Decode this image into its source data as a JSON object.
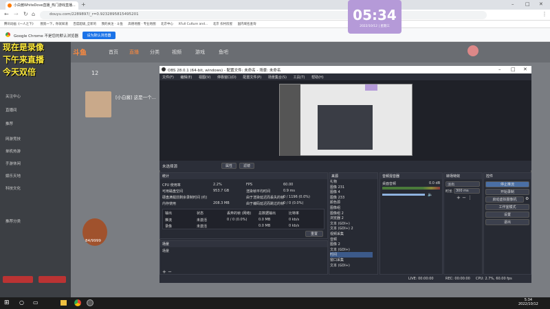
{
  "browser": {
    "tab_title": "小白酱WhiteDove直播_热门游戏直播...",
    "url": "douyu.com/2289897/_r=0.9232895815495201",
    "bookmarks": [
      "腾讯动画《一人之下》",
      "图宽一下，你就知道",
      "百度超级_全新的",
      "我的关注 · 斗鱼",
      "高德地图 · 专业地图",
      "北京中心",
      "XFull Culture and...",
      "北京 农村房屋",
      "国内域名查询"
    ],
    "info_text": "Google Chrome 不是您的默认浏览器",
    "info_button": "设为默认浏览器"
  },
  "clock": {
    "time": "05:34",
    "date": "2022/10/12 | 星期三"
  },
  "overlay": {
    "line1": "现在是录像",
    "line2": "下午来直播",
    "line3": "今天双倍"
  },
  "site": {
    "logo": "斗鱼",
    "nav": [
      "首页",
      "直播",
      "分类",
      "视频",
      "游戏",
      "鱼吧"
    ],
    "sidebar": [
      "关注中心",
      "直播间",
      "推荐",
      "网游竞技",
      "单机热游",
      "手游休闲",
      "娱乐天地",
      "科技文化",
      "推荐分类"
    ],
    "streamer_name": "[小白酱] 这是一个...",
    "follow_count": "12",
    "badge": "84/9999"
  },
  "obs": {
    "title": "OBS 28.0.1 (64-bit, windows) - 配置文件: 未命名 - 场景: 未命名",
    "menu": [
      "文件(F)",
      "编辑(E)",
      "视图(V)",
      "停靠窗口(D)",
      "配置文件(P)",
      "场景集合(S)",
      "工具(T)",
      "帮助(H)"
    ],
    "scene_label": "未选择源",
    "properties_btn": "属性",
    "filters_btn": "滤镜",
    "stats": {
      "title": "统计",
      "cpu_label": "CPU 使用率",
      "cpu": "2.2%",
      "fps_label": "FPS",
      "fps": "60.00",
      "disk_label": "可用磁盘空间",
      "disk": "953.7 GB",
      "render_label": "渲染帧平均时间",
      "render": "0.9 ms",
      "diskrec_label": "硬盘满载前剩余录制时间 (约)",
      "diskrec": "",
      "skipped_label": "由于渲染延迟而丢失的帧",
      "skipped": "0 / 1196 (0.0%)",
      "mem_label": "内存使用",
      "mem": "208.3 MB",
      "lagged_label": "由于编码延迟而跳过的帧",
      "lagged": "0 / 0 (0.0%)",
      "cols": [
        "输出",
        "状态",
        "丢弃的帧 (网络)",
        "总数据输出",
        "比特率"
      ],
      "rows": [
        [
          "推流",
          "未激活",
          "0 / 0 (0.0%)",
          "0.0 MB",
          "0 kb/s"
        ],
        [
          "录像",
          "未激活",
          "",
          "0.0 MB",
          "0 kb/s"
        ]
      ],
      "reset": "重置"
    },
    "scenes": {
      "title": "场景",
      "items": [
        "场景"
      ]
    },
    "sources": {
      "title": "来源",
      "items": [
        "礼物",
        "图像 231",
        "图像 4",
        "图像 233",
        "颜色源",
        "图像组",
        "图像组 2",
        "浏览器 2",
        "文本 (GDI+)",
        "文本 (GDI+) 2",
        "视频采集",
        "音频",
        "图像 2",
        "文本 (GDI+)",
        "时间",
        "窗口采集",
        "文本 (GDI+)"
      ]
    },
    "mixer": {
      "title": "音频混音器",
      "channel": "桌面音频",
      "level": "0.0 dB"
    },
    "transitions": {
      "title": "转场特效",
      "type": "淡出",
      "duration_label": "时长",
      "duration": "300 ms"
    },
    "controls": {
      "title": "控件",
      "buttons": [
        "停止推流",
        "开始录制",
        "启动虚拟摄像机",
        "工作室模式",
        "设置",
        "退出"
      ]
    },
    "status": {
      "live": "LIVE: 00:00:00",
      "rec": "REC: 00:00:00",
      "cpu": "CPU: 2.7%, 60.00 fps"
    }
  },
  "taskbar": {
    "time": "5:34",
    "date": "2022/10/12"
  }
}
